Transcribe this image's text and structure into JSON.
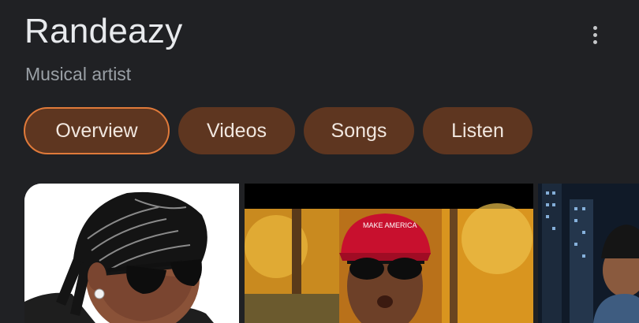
{
  "header": {
    "title": "Randeazy",
    "subtitle": "Musical artist",
    "more_icon": "more-vert-icon"
  },
  "tabs": [
    {
      "label": "Overview",
      "active": true
    },
    {
      "label": "Videos",
      "active": false
    },
    {
      "label": "Songs",
      "active": false
    },
    {
      "label": "Listen",
      "active": false
    }
  ],
  "images": [
    {
      "kind": "artist-portrait"
    },
    {
      "kind": "video-thumbnail",
      "cap_text": "MAKE AMERICA"
    },
    {
      "kind": "photo-city-night"
    }
  ],
  "colors": {
    "background": "#202124",
    "chip": "#5e3620",
    "chip_active_border": "#e07a3a",
    "cap_red": "#c8102e"
  }
}
